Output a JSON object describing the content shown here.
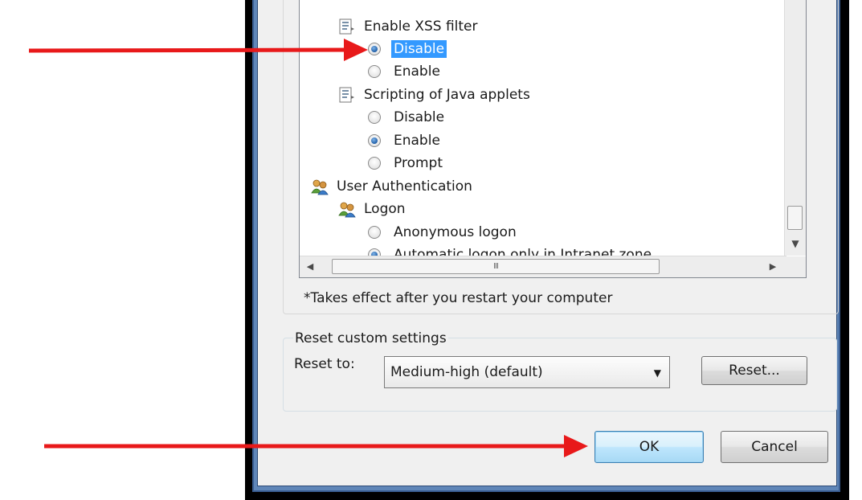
{
  "tree": {
    "items": [
      {
        "kind": "category",
        "icon": "doc-settings-icon",
        "label": "Enable XSS filter"
      },
      {
        "kind": "radio",
        "checked": true,
        "selected": true,
        "label": "Disable"
      },
      {
        "kind": "radio",
        "checked": false,
        "label": "Enable"
      },
      {
        "kind": "category",
        "icon": "doc-settings-icon",
        "label": "Scripting of Java applets"
      },
      {
        "kind": "radio",
        "checked": false,
        "label": "Disable"
      },
      {
        "kind": "radio",
        "checked": true,
        "label": "Enable"
      },
      {
        "kind": "radio",
        "checked": false,
        "label": "Prompt"
      },
      {
        "kind": "category",
        "icon": "users-icon",
        "label": "User Authentication"
      },
      {
        "kind": "category",
        "icon": "users-icon",
        "label": "Logon"
      },
      {
        "kind": "radio",
        "checked": false,
        "label": "Anonymous logon"
      },
      {
        "kind": "radio",
        "checked": true,
        "label": "Automatic logon only in Intranet zone"
      }
    ],
    "hscroll_grip": "III"
  },
  "note": "*Takes effect after you restart your computer",
  "reset_group": {
    "title": "Reset custom settings",
    "reset_to_label": "Reset to:",
    "selected_value": "Medium-high (default)",
    "reset_button": "Reset..."
  },
  "footer": {
    "ok_label": "OK",
    "cancel_label": "Cancel"
  },
  "colors": {
    "selection": "#3399ff",
    "annotation_arrow": "#e8191a",
    "frame_blue": "#5f86b8"
  }
}
